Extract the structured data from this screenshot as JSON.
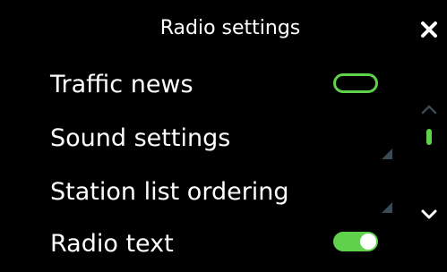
{
  "header": {
    "title": "Radio settings"
  },
  "icons": {
    "close": "close-icon",
    "scroll_up": "chevron-up-icon",
    "scroll_down": "chevron-down-icon",
    "submenu": "submenu-corner-icon"
  },
  "colors": {
    "background": "#000000",
    "text": "#ffffff",
    "accent": "#5fd14a",
    "muted": "#3a4a55"
  },
  "settings": {
    "items": [
      {
        "label": "Traffic news",
        "control": "toggle",
        "state": "off"
      },
      {
        "label": "Sound settings",
        "control": "submenu"
      },
      {
        "label": "Station list ordering",
        "control": "submenu"
      },
      {
        "label": "Radio text",
        "control": "toggle",
        "state": "on"
      }
    ]
  },
  "scrollbar": {
    "up_enabled": false,
    "down_enabled": true,
    "position": 0.15
  }
}
